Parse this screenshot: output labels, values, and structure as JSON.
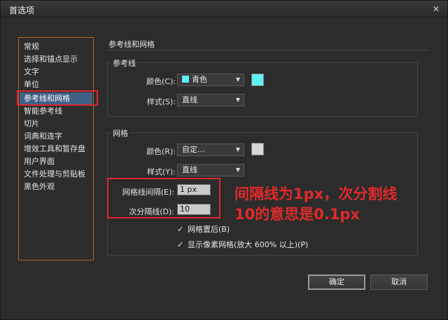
{
  "window": {
    "title": "首选项",
    "close_glyph": "✕"
  },
  "sidebar": {
    "items": [
      {
        "label": "常规"
      },
      {
        "label": "选择和锚点显示"
      },
      {
        "label": "文字"
      },
      {
        "label": "单位"
      },
      {
        "label": "参考线和网格",
        "selected": true
      },
      {
        "label": "智能参考线"
      },
      {
        "label": "切片"
      },
      {
        "label": "词典和连字"
      },
      {
        "label": "增效工具和暂存盘"
      },
      {
        "label": "用户界面"
      },
      {
        "label": "文件处理与剪贴板"
      },
      {
        "label": "黑色外观"
      }
    ]
  },
  "panel": {
    "heading": "参考线和网格",
    "guides": {
      "group_label": "参考线",
      "color_label": "颜色(C):",
      "color_value": "青色",
      "color_swatch": "#5ff0f5",
      "style_label": "样式(S):",
      "style_value": "直线"
    },
    "grid": {
      "group_label": "网格",
      "color_label": "颜色(R):",
      "color_value": "自定...",
      "color_swatch": "#d6d6d6",
      "style_label": "样式(Y):",
      "style_value": "直线",
      "gridline_every_label": "网格线间隔(E):",
      "gridline_every_value": "1 px",
      "subdivisions_label": "次分隔线(D):",
      "subdivisions_value": "10",
      "grids_in_back_label": "网格置后(B)",
      "grids_in_back_checked": true,
      "show_pixel_grid_label": "显示像素网格(放大 600% 以上)(P)",
      "show_pixel_grid_checked": true
    }
  },
  "annotation": {
    "line1": "间隔线为1px，次分割线",
    "line2": "10的意思是0.1px",
    "color": "#e02a2a"
  },
  "buttons": {
    "ok_label": "确定",
    "cancel_label": "取消"
  },
  "dropdown_arrow_glyph": "▼",
  "check_glyph": "✓"
}
